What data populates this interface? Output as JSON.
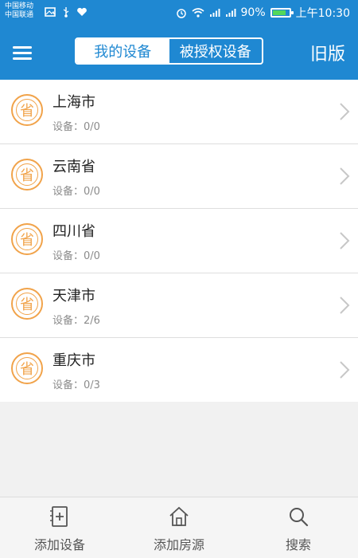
{
  "statusbar": {
    "carrier_line1": "中国移动",
    "carrier_line2": "中国联通",
    "battery_text": "90%",
    "battery_level": 0.9,
    "time": "上午10:30",
    "icons": [
      "image-icon",
      "usb-icon",
      "heart-icon",
      "alarm-icon",
      "wifi-icon",
      "signal-icon",
      "signal-icon-2",
      "battery-icon"
    ]
  },
  "topbar": {
    "menu_icon": "menu-icon",
    "tab_mine": "我的设备",
    "tab_authorized": "被授权设备",
    "old_version": "旧版"
  },
  "badge_text": "省",
  "devices": [
    {
      "name": "上海市",
      "devices": "设备：0/0"
    },
    {
      "name": "云南省",
      "devices": "设备：0/0"
    },
    {
      "name": "四川省",
      "devices": "设备：0/0"
    },
    {
      "name": "天津市",
      "devices": "设备：2/6"
    },
    {
      "name": "重庆市",
      "devices": "设备：0/3"
    }
  ],
  "bottom_nav": {
    "add_device": "添加设备",
    "add_house": "添加房源",
    "search": "搜索"
  },
  "colors": {
    "primary": "#1f88d2",
    "accent": "#f1a34a",
    "background": "#f1f1f1"
  }
}
